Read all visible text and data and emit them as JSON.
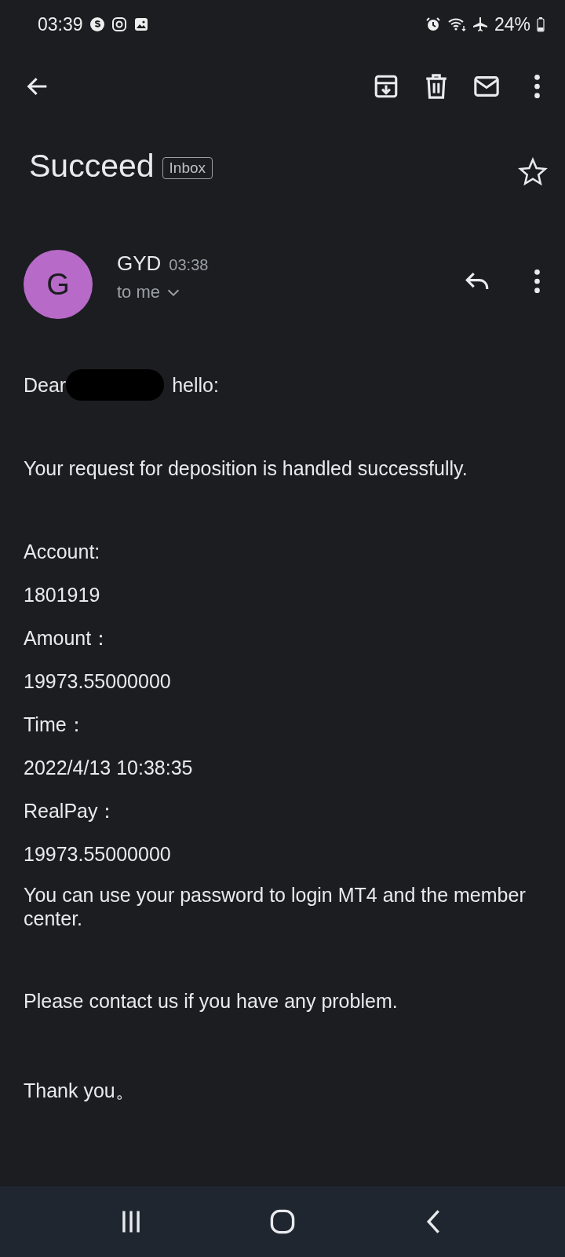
{
  "status_bar": {
    "time": "03:39",
    "battery_text": "24%"
  },
  "email": {
    "subject": "Succeed",
    "label": "Inbox",
    "starred": false,
    "sender": {
      "initial": "G",
      "name": "GYD",
      "time": "03:38",
      "recipient": "to me"
    },
    "greeting": {
      "before": "Dear",
      "after": "hello:",
      "redacted": true
    },
    "body": [
      {
        "text": "Your request for deposition is handled successfully."
      },
      {
        "text": "Account:"
      },
      {
        "text": "1801919"
      },
      {
        "text": "Amount："
      },
      {
        "text": "19973.55000000"
      },
      {
        "text": "Time："
      },
      {
        "text": "2022/4/13 10:38:35"
      },
      {
        "text": "RealPay："
      },
      {
        "text": "19973.55000000"
      },
      {
        "text": "You can use your password to login MT4 and the member center."
      },
      {
        "text": "Please contact us if you have any problem."
      },
      {
        "text": "Thank you。"
      }
    ]
  }
}
